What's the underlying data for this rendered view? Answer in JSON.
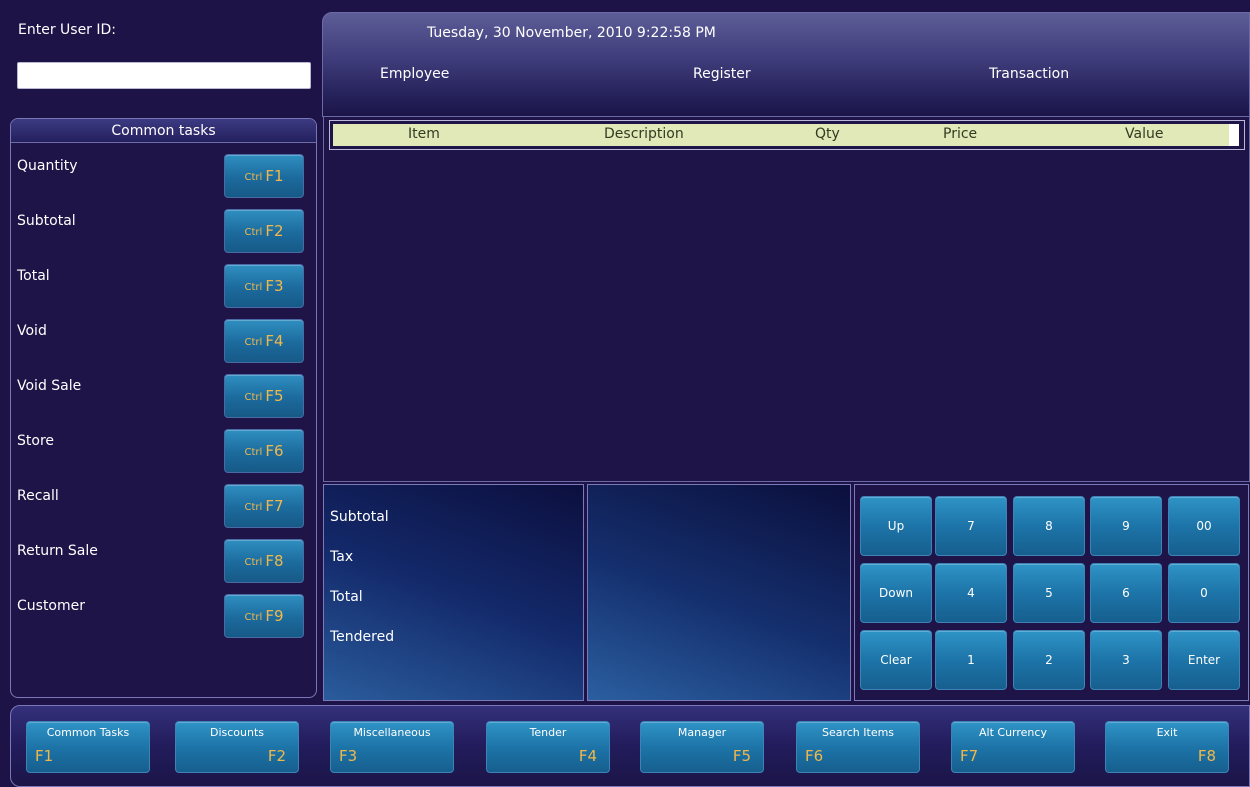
{
  "login": {
    "label": "Enter User ID:",
    "input_value": "",
    "input_placeholder": ""
  },
  "common_tasks": {
    "title": "Common tasks",
    "items": [
      {
        "label": "Quantity",
        "ctrl": "Ctrl",
        "key": "F1"
      },
      {
        "label": "Subtotal",
        "ctrl": "Ctrl",
        "key": "F2"
      },
      {
        "label": "Total",
        "ctrl": "Ctrl",
        "key": "F3"
      },
      {
        "label": "Void",
        "ctrl": "Ctrl",
        "key": "F4"
      },
      {
        "label": "Void Sale",
        "ctrl": "Ctrl",
        "key": "F5"
      },
      {
        "label": "Store",
        "ctrl": "Ctrl",
        "key": "F6"
      },
      {
        "label": "Recall",
        "ctrl": "Ctrl",
        "key": "F7"
      },
      {
        "label": "Return Sale",
        "ctrl": "Ctrl",
        "key": "F8"
      },
      {
        "label": "Customer",
        "ctrl": "Ctrl",
        "key": "F9"
      }
    ]
  },
  "info_bar": {
    "datetime": "Tuesday, 30 November, 2010 9:22:58 PM",
    "employee": "Employee",
    "register": "Register",
    "transaction": "Transaction"
  },
  "grid": {
    "columns": [
      "Item",
      "Description",
      "Qty",
      "Price",
      "Value"
    ],
    "rows": []
  },
  "totals": {
    "subtotal": "Subtotal",
    "tax": "Tax",
    "total": "Total",
    "tendered": "Tendered"
  },
  "keypad": {
    "keys": [
      [
        "Up",
        "7",
        "8",
        "9",
        "00"
      ],
      [
        "Down",
        "4",
        "5",
        "6",
        "0"
      ],
      [
        "Clear",
        "1",
        "2",
        "3",
        "Enter"
      ]
    ]
  },
  "function_bar": {
    "buttons": [
      {
        "label": "Common Tasks",
        "key": "F1",
        "key_align": "left"
      },
      {
        "label": "Discounts",
        "key": "F2",
        "key_align": "right"
      },
      {
        "label": "Miscellaneous",
        "key": "F3",
        "key_align": "left"
      },
      {
        "label": "Tender",
        "key": "F4",
        "key_align": "right"
      },
      {
        "label": "Manager",
        "key": "F5",
        "key_align": "right"
      },
      {
        "label": "Search Items",
        "key": "F6",
        "key_align": "left"
      },
      {
        "label": "Alt Currency",
        "key": "F7",
        "key_align": "left"
      },
      {
        "label": "Exit",
        "key": "F8",
        "key_align": "right"
      }
    ]
  },
  "colors": {
    "background": "#1d1347",
    "button_blue": "#1d74a8",
    "key_accent": "#f0b84a",
    "grid_header": "#e1e9b9"
  }
}
